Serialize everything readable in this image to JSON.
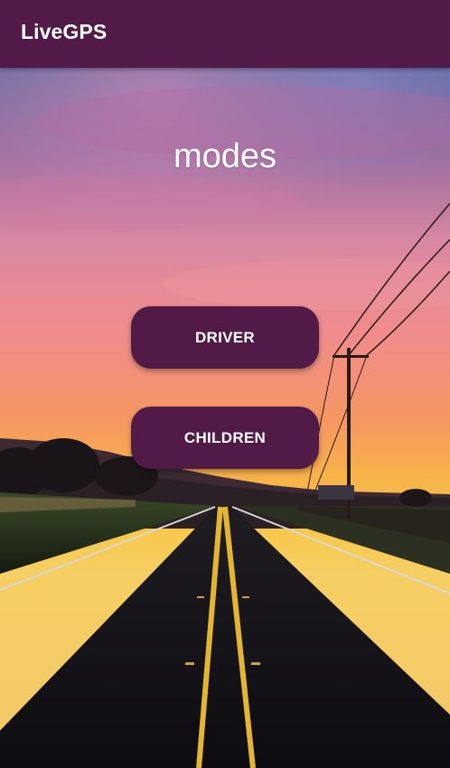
{
  "app_bar": {
    "title": "LiveGPS"
  },
  "main": {
    "heading": "modes",
    "buttons": {
      "driver": "DRIVER",
      "children": "CHILDREN"
    }
  },
  "colors": {
    "primary": "#521b47",
    "text_on_primary": "#ffffff"
  },
  "background": {
    "scene": "sunset-highway-image"
  }
}
